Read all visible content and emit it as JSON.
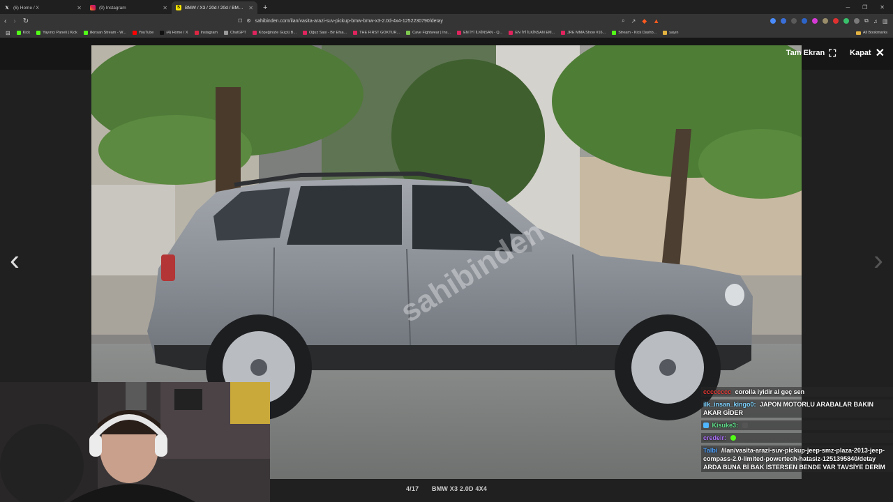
{
  "browser": {
    "tabs": [
      {
        "title": "(6) Home / X",
        "icon": "x-logo-icon",
        "active": false
      },
      {
        "title": "(9) Instagram",
        "icon": "instagram-icon",
        "active": false
      },
      {
        "title": "BMW / X3 / 20d / 20d / BMW X",
        "icon": "sahibinden-icon",
        "active": true
      }
    ],
    "url": "sahibinden.com/ilan/vasita-arazi-suv-pickup-bmw-bmw-x3-2.0d-4x4-1252230790/detay",
    "bookmarks": [
      {
        "label": "Kick",
        "color": "#53fc18"
      },
      {
        "label": "Yayıncı Paneli | Kick",
        "color": "#53fc18"
      },
      {
        "label": "ilkinsan Stream - W...",
        "color": "#53fc18"
      },
      {
        "label": "YouTube",
        "color": "#ff0000"
      },
      {
        "label": "(4) Home / X",
        "color": "#111111"
      },
      {
        "label": "Instagram",
        "color": "#dc2743"
      },
      {
        "label": "ChatGPT",
        "color": "#9a9a9a"
      },
      {
        "label": "Köpeğinizle Güçlü B...",
        "color": "#e0245e"
      },
      {
        "label": "Oğuz Sasi - Bir Efsa...",
        "color": "#e0245e"
      },
      {
        "label": "THE FIRST GOKTUR...",
        "color": "#e0245e"
      },
      {
        "label": "Cave Fightwear | Ins...",
        "color": "#7ec850"
      },
      {
        "label": "EN İYİ İLKİNSAN - Q...",
        "color": "#e0245e"
      },
      {
        "label": "EN İYİ İLKİNSAN EM...",
        "color": "#e0245e"
      },
      {
        "label": "JRE MMA Show #16...",
        "color": "#e0245e"
      },
      {
        "label": "Stream - Kick Dashb...",
        "color": "#53fc18"
      },
      {
        "label": "yayın",
        "color": "#e3b341"
      }
    ],
    "all_bookmarks": "All Bookmarks"
  },
  "viewer": {
    "fullscreen_label": "Tam Ekran",
    "close_label": "Kapat",
    "watermark": "sahibinden",
    "counter": "4/17",
    "caption": "BMW X3 2.0D 4X4"
  },
  "chat": [
    {
      "user": "cccccccc",
      "user_color": "#e53935",
      "text": "corolla iyidir al geç sen"
    },
    {
      "user": "ilk_insan_kingo0:",
      "user_color": "#7fd3ff",
      "text": "JAPON MOTORLU ARABALAR BAKIN AKAR GİDER"
    },
    {
      "user": "Kisuke3:",
      "user_color": "#5fe08a",
      "text": ""
    },
    {
      "user": "credeir:",
      "user_color": "#b072ff",
      "text": ""
    },
    {
      "user": "Talbi",
      "user_color": "#4fa3ff",
      "text": "/ilan/vasita-arazi-suv-pickup-jeep-smz-plaza-2013-jeep-compass-2.0-limited-powertech-hatasiz-1251395840/detay ARDA BUNA Bİ BAK İSTERSEN BENDE VAR TAVSİYE DERİM"
    }
  ],
  "colors": {
    "accent": "#53fc18",
    "tab_active": "#353535"
  }
}
